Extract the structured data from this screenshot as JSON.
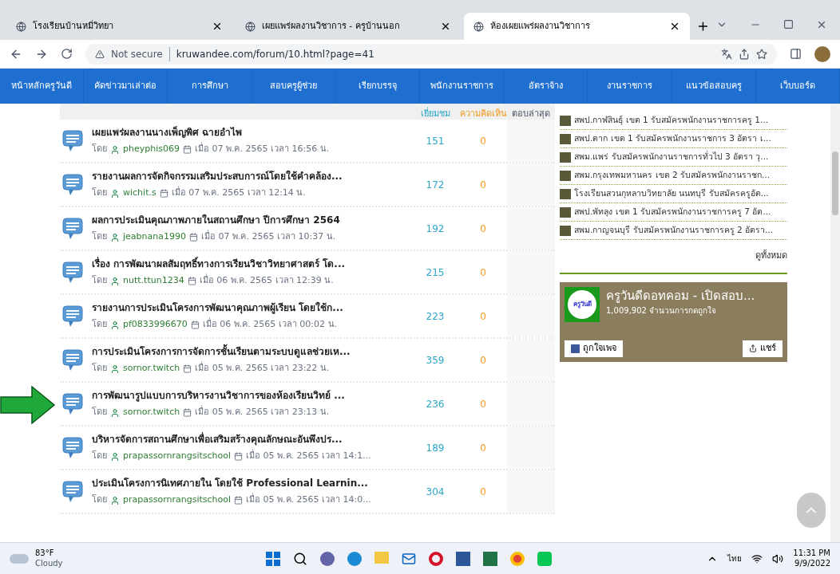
{
  "browser": {
    "tabs": [
      {
        "title": "โรงเรียนบ้านหมี่วิทยา",
        "selected": false
      },
      {
        "title": "เผยแพร่ผลงานวิชาการ - ครูบ้านนอก",
        "selected": false
      },
      {
        "title": "ห้องเผยแพร่ผลงานวิชาการ",
        "selected": true
      }
    ],
    "security": "Not secure",
    "url": "kruwandee.com/forum/10.html?page=41"
  },
  "nav": [
    "หน้าหลักครูวันดี",
    "คัดข่าวมาเล่าต่อ",
    "การศึกษา",
    "สอบครูผู้ช่วย",
    "เรียกบรรจุ",
    "พนักงานราชการ",
    "อัตราจ้าง",
    "งานราชการ",
    "แนวข้อสอบครู",
    "เว็บบอร์ด"
  ],
  "columns": [
    "เยี่ยมชม",
    "ความคิดเห็น",
    "ตอบล่าสุด"
  ],
  "topics": [
    {
      "title": "เผยแพร่ผลงานนางเพ็ญพิศ ฉายอำไพ",
      "by": "โดย",
      "author": "pheyphis069",
      "date": "เมื่อ 07 พ.ค. 2565 เวลา 16:56 น.",
      "views": "151",
      "comments": "0",
      "marked": false
    },
    {
      "title": "รายงานผลการจัดกิจกรรมเสริมประสบการณ์โดยใช้คำคล้อง...",
      "by": "โดย",
      "author": "wichit.s",
      "date": "เมื่อ 07 พ.ค. 2565 เวลา 12:14 น.",
      "views": "172",
      "comments": "0",
      "marked": false
    },
    {
      "title": "ผลการประเมินคุณภาพภายในสถานศึกษา ปีการศึกษา 2564",
      "by": "โดย",
      "author": "jeabnana1990",
      "date": "เมื่อ 07 พ.ค. 2565 เวลา 10:37 น.",
      "views": "192",
      "comments": "0",
      "marked": false
    },
    {
      "title": "เรื่อง การพัฒนาผลสัมฤทธิ์ทางการเรียนวิชาวิทยาศาสตร์ โด...",
      "by": "โดย",
      "author": "nutt.ttun1234",
      "date": "เมื่อ 06 พ.ค. 2565 เวลา 12:39 น.",
      "views": "215",
      "comments": "0",
      "marked": false
    },
    {
      "title": "รายงานการประเมินโครงการพัฒนาคุณภาพผู้เรียน โดยใช้ก...",
      "by": "โดย",
      "author": "pf0833996670",
      "date": "เมื่อ 06 พ.ค. 2565 เวลา 00:02 น.",
      "views": "223",
      "comments": "0",
      "marked": false
    },
    {
      "title": "การประเมินโครงการการจัดการชั้นเรียนตามระบบดูแลช่วยเห...",
      "by": "โดย",
      "author": "sornor.twitch",
      "date": "เมื่อ 05 พ.ค. 2565 เวลา 23:22 น.",
      "views": "359",
      "comments": "0",
      "marked": false
    },
    {
      "title": "การพัฒนารูปแบบการบริหารงานวิชาการของห้องเรียนวิทย์ ...",
      "by": "โดย",
      "author": "sornor.twitch",
      "date": "เมื่อ 05 พ.ค. 2565 เวลา 23:13 น.",
      "views": "236",
      "comments": "0",
      "marked": true
    },
    {
      "title": "บริหารจัดการสถานศึกษาเพื่อเสริมสร้างคุณลักษณะอันพึงปร...",
      "by": "โดย",
      "author": "prapassornrangsitschool",
      "date": "เมื่อ 05 พ.ค. 2565 เวลา 14:1...",
      "views": "189",
      "comments": "0",
      "marked": false
    },
    {
      "title": "ประเมินโครงการนิเทศภายใน โดยใช้ Professional Learnin...",
      "by": "โดย",
      "author": "prapassornrangsitschool",
      "date": "เมื่อ 05 พ.ค. 2565 เวลา 14:0...",
      "views": "304",
      "comments": "0",
      "marked": false
    }
  ],
  "sidebar": {
    "links": [
      "สพป.กาฬสินธุ์ เขต 1 รับสมัครพนักงานราชการครู 1...",
      "สพป.ตาก เขต 1 รับสมัครพนักงานราชการ 3 อัตรา เ...",
      "สพม.แพร่ รับสมัครพนักงานราชการทั่วไป 3 อัตรา วุ...",
      "สพม.กรุงเทพมหานคร เขต 2 รับสมัครพนักงานราชก...",
      "โรงเรียนสวนกุหลาบวิทยาลัย นนทบุรี รับสมัครครูอัต...",
      "สพป.พัทลุง เขต 1 รับสมัครพนักงานราชการครู 7 อัต...",
      "สพม.กาญจนบุรี รับสมัครพนักงานราชการครู 2 อัตรา..."
    ],
    "view_all": "ดูทั้งหมด",
    "page_widget": {
      "name": "ครูวันดีดอทคอม - เปิดสอบ...",
      "likes": "1,009,902 จำนวนการกดถูกใจ",
      "like_button": "ถูกใจเพจ",
      "share_button": "แชร์",
      "logo_text": "ครูวันดี"
    }
  },
  "taskbar": {
    "temp": "83°F",
    "weather": "Cloudy",
    "lang": "ไทย",
    "time": "11:31 PM",
    "date": "9/9/2022"
  }
}
